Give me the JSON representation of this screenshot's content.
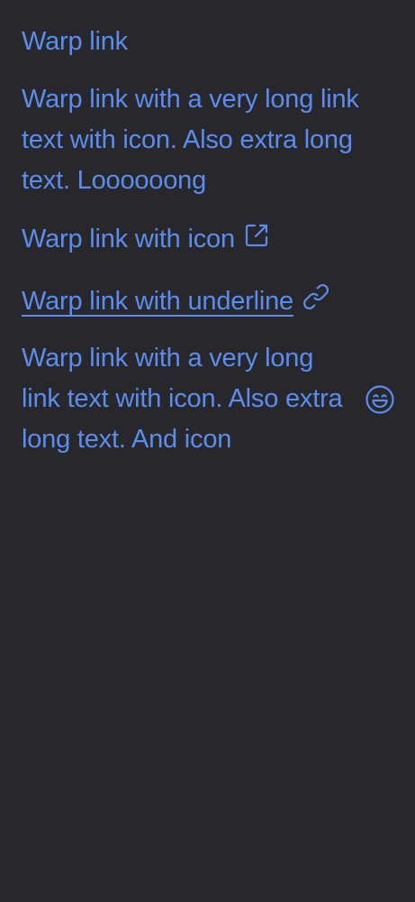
{
  "links": {
    "plain": "Warp link",
    "long": "Warp link with a very long link text with icon. Also extra long text. Loooooong",
    "with_icon": "Warp link with icon",
    "with_icon_icon": "external-link-icon",
    "underline": "Warp link with underline",
    "underline_icon": "link-icon",
    "long_icon": "Warp link with a very long link text with icon. Also extra long text. And icon",
    "long_icon_icon": "smile-icon"
  },
  "colors": {
    "background": "#28282c",
    "link": "#5b8def"
  }
}
